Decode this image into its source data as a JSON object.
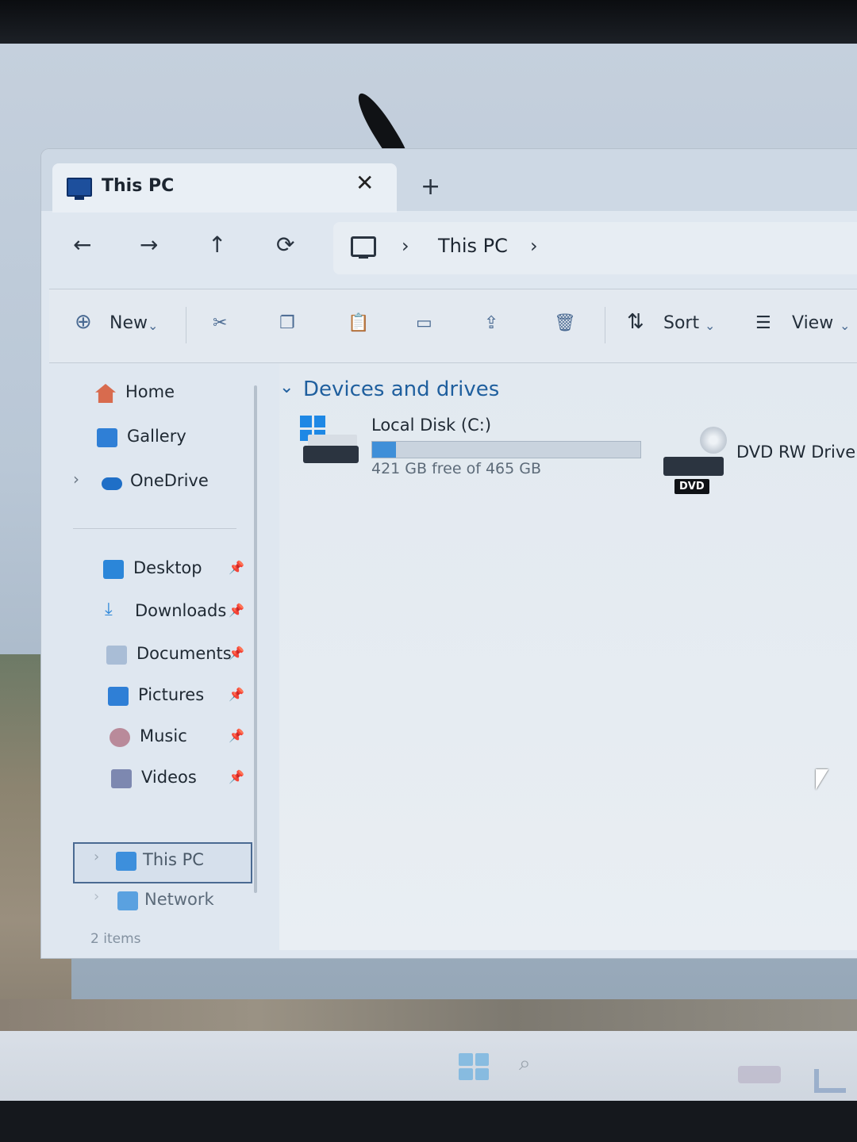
{
  "tab": {
    "title": "This PC",
    "close_glyph": "✕",
    "new_tab_glyph": "+"
  },
  "nav": {
    "back": "←",
    "forward": "→",
    "up": "↑",
    "refresh": "⟳",
    "breadcrumb": [
      "This PC"
    ],
    "chevron": "›"
  },
  "toolbar": {
    "new_label": "New",
    "sort_label": "Sort",
    "view_label": "View",
    "icons": [
      "cut-icon",
      "copy-icon",
      "paste-icon",
      "rename-icon",
      "share-icon",
      "delete-icon"
    ]
  },
  "sidebar": {
    "top": [
      {
        "label": "Home",
        "icon": "home-icon"
      },
      {
        "label": "Gallery",
        "icon": "gallery-icon"
      },
      {
        "label": "OneDrive",
        "icon": "cloud-icon"
      }
    ],
    "quick": [
      {
        "label": "Desktop",
        "icon": "desktop-icon"
      },
      {
        "label": "Downloads",
        "icon": "download-icon"
      },
      {
        "label": "Documents",
        "icon": "documents-icon"
      },
      {
        "label": "Pictures",
        "icon": "pictures-icon"
      },
      {
        "label": "Music",
        "icon": "music-icon"
      },
      {
        "label": "Videos",
        "icon": "videos-icon"
      }
    ],
    "bottom": [
      {
        "label": "This PC",
        "icon": "pc-icon",
        "selected": true
      },
      {
        "label": "Network",
        "icon": "network-icon"
      }
    ]
  },
  "content": {
    "group_title": "Devices and drives",
    "drives": [
      {
        "name": "Local Disk (C:)",
        "free_text": "421 GB free of 465 GB",
        "used_fraction": 0.09
      },
      {
        "name": "DVD RW Drive (",
        "badge": "DVD"
      }
    ]
  },
  "status": {
    "items": "2 items"
  },
  "colors": {
    "accent": "#1f5f9e",
    "bar_fill": "#3f8fd8"
  }
}
